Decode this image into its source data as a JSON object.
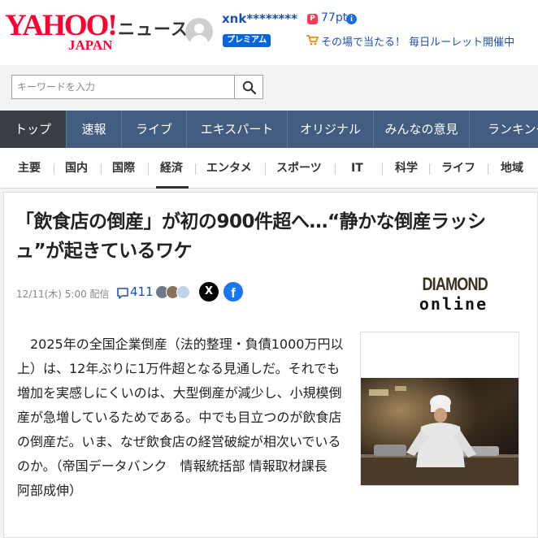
{
  "header": {
    "logo_main": "YAHOO!",
    "logo_sub": "JAPAN",
    "section_title": "ニュース",
    "username": "xnk********",
    "premium_badge": "プレミアム",
    "points_icon": "P",
    "points": "77pt",
    "info_icon": "i",
    "promo_text": "その場で当たる！ 毎日ルーレット開催中"
  },
  "search": {
    "placeholder": "キーワードを入力"
  },
  "main_nav": {
    "items": [
      {
        "label": "トップ"
      },
      {
        "label": "速報"
      },
      {
        "label": "ライブ"
      },
      {
        "label": "エキスパート"
      },
      {
        "label": "オリジナル"
      },
      {
        "label": "みんなの意見"
      },
      {
        "label": "ランキング"
      }
    ],
    "active": "トップ"
  },
  "sub_nav": {
    "items": [
      {
        "label": "主要"
      },
      {
        "label": "国内"
      },
      {
        "label": "国際"
      },
      {
        "label": "経済"
      },
      {
        "label": "エンタメ"
      },
      {
        "label": "スポーツ"
      },
      {
        "label": "IT"
      },
      {
        "label": "科学"
      },
      {
        "label": "ライフ"
      },
      {
        "label": "地域"
      }
    ],
    "active": "経済"
  },
  "article": {
    "headline": "「飲食店の倒産」が初の900件超へ…“静かな倒産ラッシュ”が起きているワケ",
    "date": "12/11(木) 5:00",
    "distribution": "配信",
    "comment_count": "411",
    "share_x": "X",
    "share_fb": "f",
    "source_top": "DIAMOND",
    "source_bottom": "online",
    "body": "　2025年の全国企業倒産（法的整理・負債1000万円以上）は、12年ぶりに1万件超となる見通しだ。それでも増加を実感しにくいのは、大型倒産が減少し、小規模倒産が急増しているためである。中でも目立つのが飲食店の倒産だ。いま、なぜ飲食店の経営破綻が相次いでいるのか。（帝国データバンク　情報統括部 情報取材課長　阿部成伸）"
  },
  "colors": {
    "brand_red": "#ff0033",
    "nav_bg": "#425d7f",
    "nav_active": "#3a3f45",
    "link_blue": "#1a4fb5",
    "facebook_blue": "#1877f2"
  }
}
